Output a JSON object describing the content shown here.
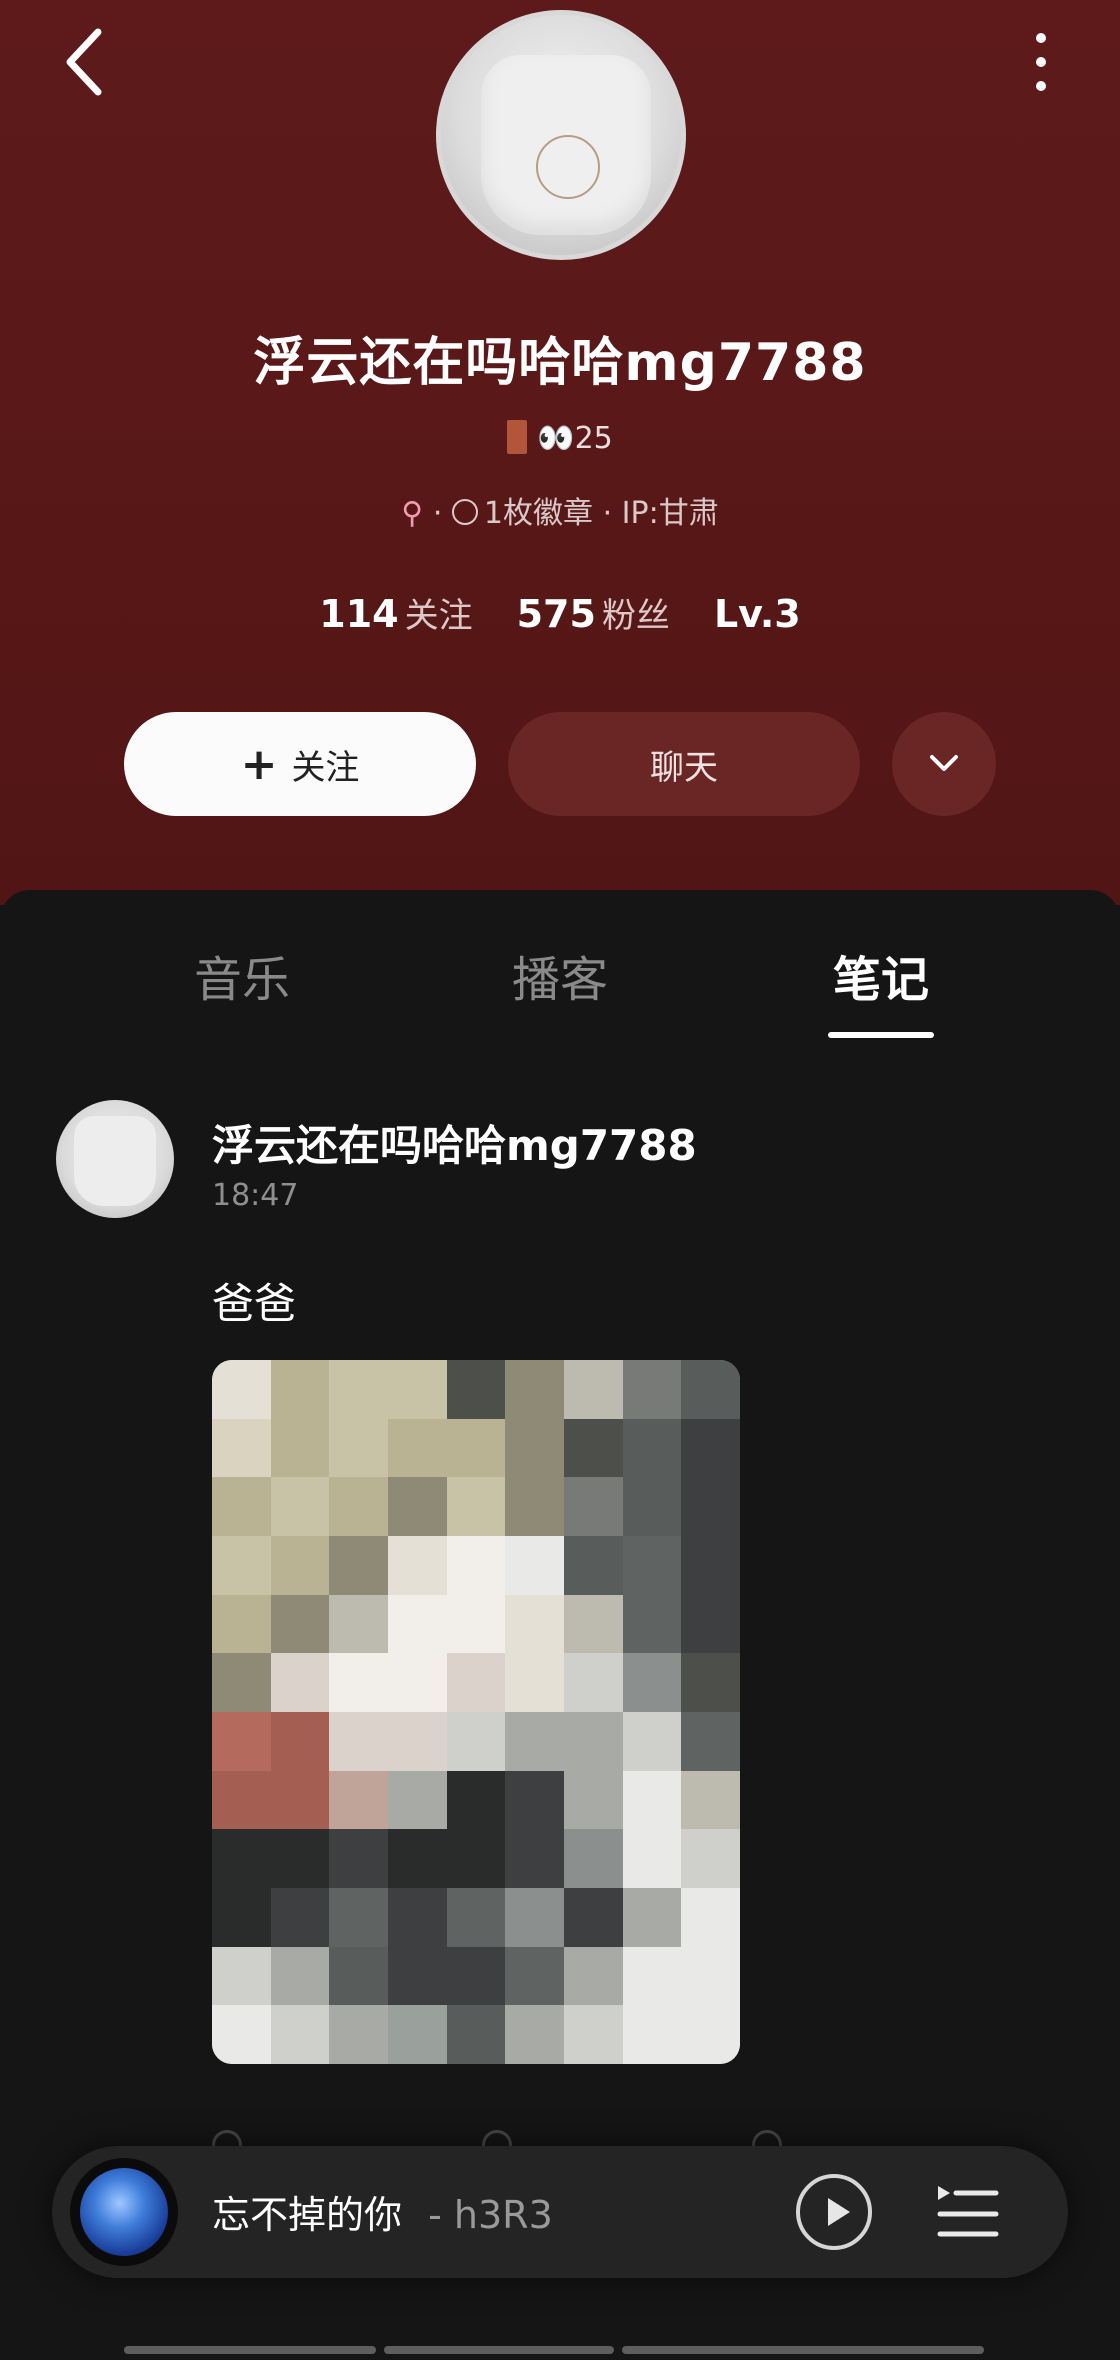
{
  "profile": {
    "username": "浮云还在吗哈哈mg7788",
    "badge_line": "👀25",
    "meta_sep": "·",
    "badges_count": "1枚徽章",
    "ip_location": "IP:甘肃",
    "stats": {
      "following_count": "114",
      "following_label": "关注",
      "followers_count": "575",
      "followers_label": "粉丝",
      "level": "Lv.3"
    },
    "follow_button": "关注",
    "chat_button": "聊天"
  },
  "tabs": [
    {
      "label": "音乐",
      "active": false
    },
    {
      "label": "播客",
      "active": false
    },
    {
      "label": "笔记",
      "active": true
    }
  ],
  "post": {
    "author": "浮云还在吗哈哈mg7788",
    "time": "18:47",
    "text": "爸爸",
    "image_censored": true
  },
  "player": {
    "song_title": "忘不掉的你",
    "separator": "-",
    "artist": "h3R3"
  },
  "colors": {
    "header_bg": "#5a1818",
    "content_bg": "#151515",
    "follow_button_bg": "#fbfbfb",
    "chat_button_bg": "#6a2525",
    "active_tab": "#ffffff",
    "inactive_tab": "#8a8a8a"
  },
  "icons": [
    "back-icon",
    "more-vertical-icon",
    "chevron-down-icon",
    "play-icon",
    "playlist-icon"
  ]
}
